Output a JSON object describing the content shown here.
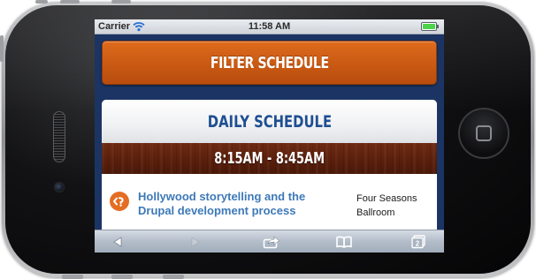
{
  "status_bar": {
    "carrier": "Carrier",
    "time": "11:58 AM",
    "battery_color": "#4bd34a"
  },
  "filter": {
    "label": "FILTER SCHEDULE",
    "color": "#d2601a"
  },
  "schedule": {
    "heading": "DAILY SCHEDULE",
    "time_slot": "8:15AM - 8:45AM",
    "sessions": [
      {
        "title": "Hollywood storytelling and the Drupal development process",
        "room_line1": "Four Seasons",
        "room_line2": "Ballroom",
        "icon": "drupal-icon"
      }
    ]
  },
  "toolbar": {
    "back_icon": "back-arrow-icon",
    "forward_icon": "forward-arrow-icon",
    "share_icon": "share-icon",
    "bookmarks_icon": "bookmarks-icon",
    "tabs_icon": "tabs-icon",
    "tabs_count": "2"
  },
  "colors": {
    "page_background": "#1b3463",
    "link": "#3d79b8",
    "heading": "#1e4f92",
    "wood": "#5c200c"
  }
}
